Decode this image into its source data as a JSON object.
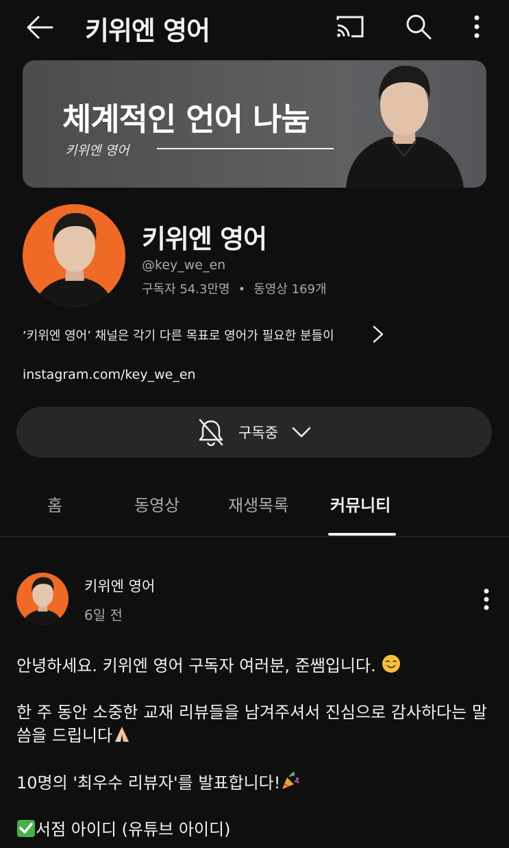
{
  "header": {
    "title": "키위엔 영어",
    "icons": [
      "back-arrow-icon",
      "cast-icon",
      "search-icon",
      "more-vert-icon"
    ]
  },
  "banner": {
    "headline": "체계적인 언어 나눔",
    "sub": "키위엔 영어"
  },
  "channel": {
    "name": "키위엔 영어",
    "handle": "@key_we_en",
    "subscribers": "구독자 54.3만명",
    "separator": "•",
    "videos": "동영상 169개",
    "description": "‘키위엔 영어’ 채널은 각기 다른 목표로 영어가 필요한 분들이",
    "link": "instagram.com/key_we_en",
    "subscribe_label": "구독중"
  },
  "tabs": [
    {
      "label": "홈",
      "active": false
    },
    {
      "label": "동영상",
      "active": false
    },
    {
      "label": "재생목록",
      "active": false
    },
    {
      "label": "커뮤니티",
      "active": true
    }
  ],
  "post": {
    "author": "키위엔 영어",
    "time": "6일 전",
    "line1": "안녕하세요. 키위엔 영어 구독자 여러분, 준쌤입니다.",
    "line2": "한 주 동안 소중한 교재 리뷰들을 남겨주셔서 진심으로 감사하다는 말씀을 드립니다",
    "line3": "10명의 '최우수 리뷰자'를 발표합니다!",
    "line4": "서점 아이디 (유튜브 아이디)"
  },
  "colors": {
    "background": "#0f0f0f",
    "avatar_bg": "#f06a27",
    "button_bg": "#272727",
    "secondary_text": "#aaaaaa"
  }
}
